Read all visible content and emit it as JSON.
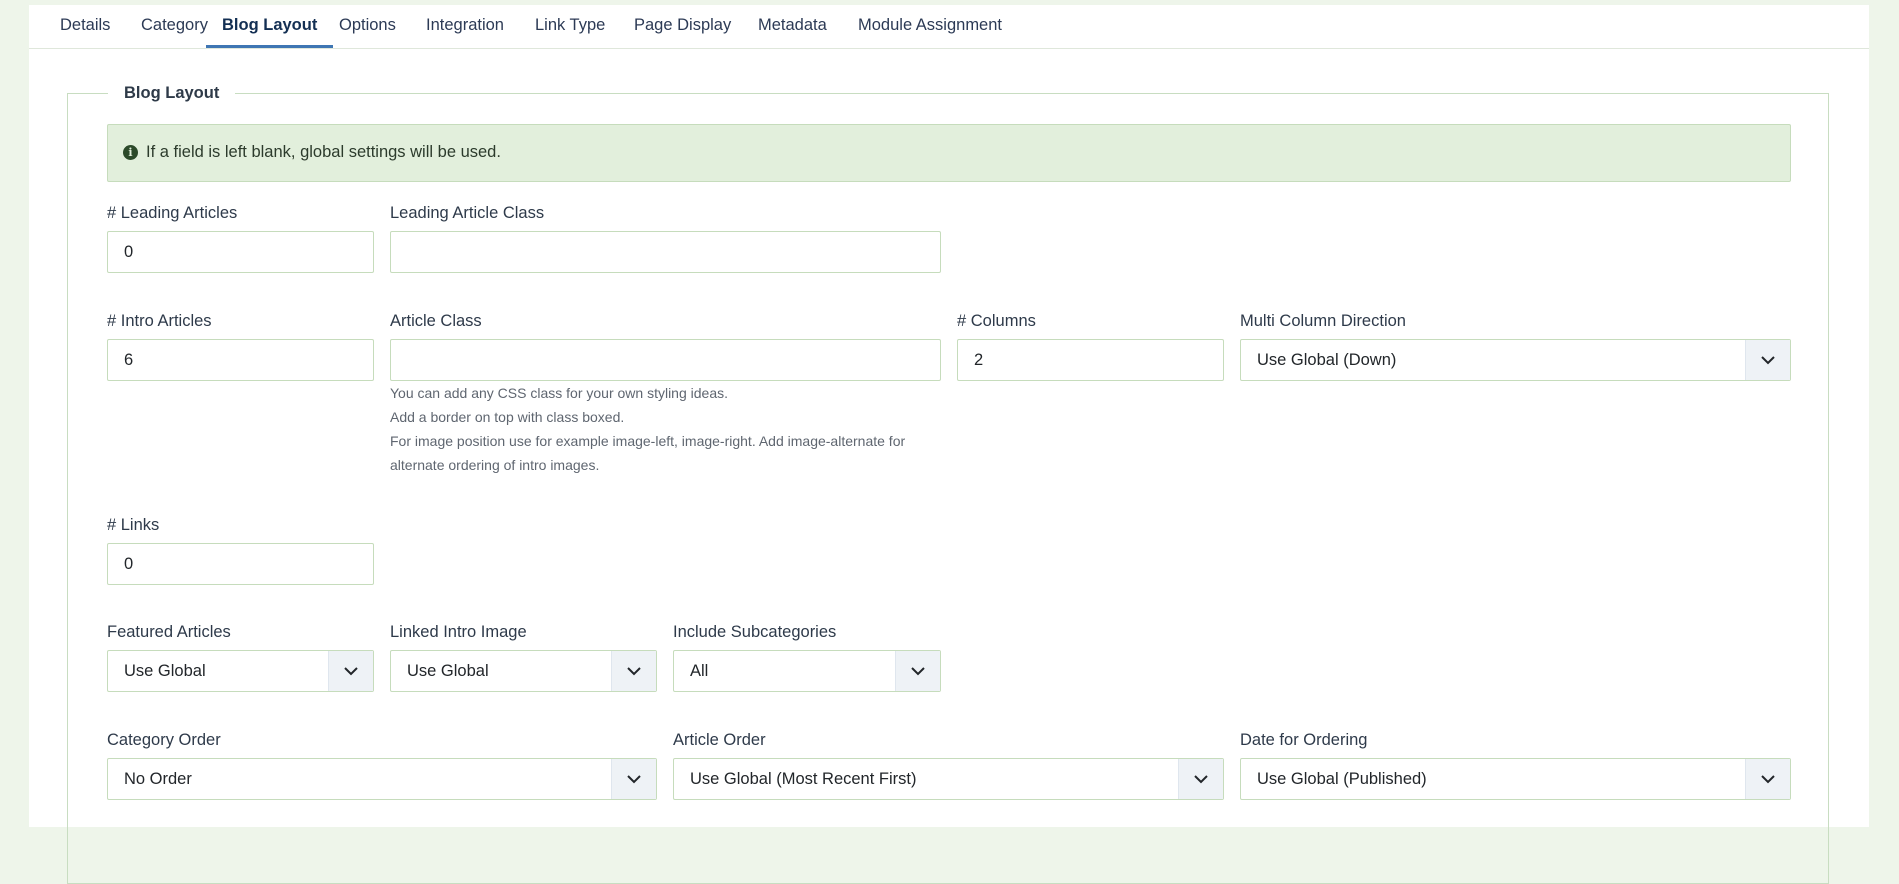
{
  "tabs": [
    "Details",
    "Category",
    "Blog Layout",
    "Options",
    "Integration",
    "Link Type",
    "Page Display",
    "Metadata",
    "Module Assignment"
  ],
  "active_tab": "Blog Layout",
  "section": {
    "legend": "Blog Layout"
  },
  "alert": {
    "icon": "info-circle-icon",
    "text": "If a field is left blank, global settings will be used."
  },
  "fields": {
    "leading_articles": {
      "label": "# Leading Articles",
      "value": "0"
    },
    "leading_article_class": {
      "label": "Leading Article Class",
      "value": ""
    },
    "intro_articles": {
      "label": "# Intro Articles",
      "value": "6"
    },
    "article_class": {
      "label": "Article Class",
      "value": "",
      "help": [
        "You can add any CSS class for your own styling ideas.",
        "Add a border on top with class boxed.",
        "For image position use for example image-left, image-right. Add image-alternate for",
        "alternate ordering of intro images."
      ]
    },
    "columns": {
      "label": "# Columns",
      "value": "2"
    },
    "multi_column_direction": {
      "label": "Multi Column Direction",
      "value": "Use Global (Down)"
    },
    "links": {
      "label": "# Links",
      "value": "0"
    },
    "featured_articles": {
      "label": "Featured Articles",
      "value": "Use Global"
    },
    "linked_intro_image": {
      "label": "Linked Intro Image",
      "value": "Use Global"
    },
    "include_subcategories": {
      "label": "Include Subcategories",
      "value": "All"
    },
    "category_order": {
      "label": "Category Order",
      "value": "No Order"
    },
    "article_order": {
      "label": "Article Order",
      "value": "Use Global (Most Recent First)"
    },
    "date_for_ordering": {
      "label": "Date for Ordering",
      "value": "Use Global (Published)"
    }
  },
  "colors": {
    "accent": "#3f76b3",
    "field_border": "#c6dcbc",
    "alert_bg": "#e2efdc",
    "page_bg": "#eef5ea"
  }
}
